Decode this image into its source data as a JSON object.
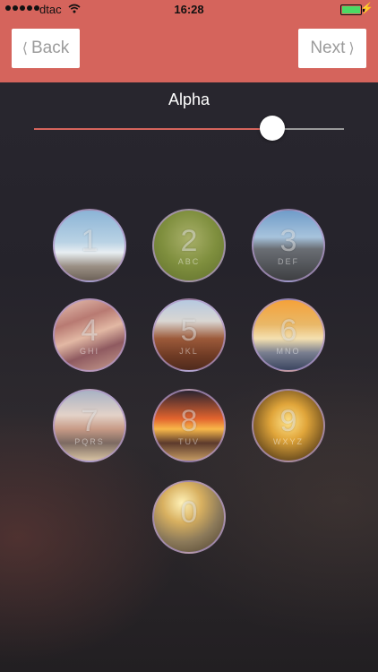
{
  "status_bar": {
    "carrier": "dtac",
    "time": "16:28"
  },
  "nav": {
    "back_label": "Back",
    "next_label": "Next",
    "back_chevron": "⟨",
    "next_chevron": "⟩"
  },
  "alpha": {
    "label": "Alpha",
    "value": 0.77
  },
  "colors": {
    "accent": "#d5645c",
    "key_border": "#af96c8"
  },
  "keypad": {
    "keys": [
      {
        "digit": "1",
        "letters": ""
      },
      {
        "digit": "2",
        "letters": "ABC"
      },
      {
        "digit": "3",
        "letters": "DEF"
      },
      {
        "digit": "4",
        "letters": "GHI"
      },
      {
        "digit": "5",
        "letters": "JKL"
      },
      {
        "digit": "6",
        "letters": "MNO"
      },
      {
        "digit": "7",
        "letters": "PQRS"
      },
      {
        "digit": "8",
        "letters": "TUV"
      },
      {
        "digit": "9",
        "letters": "WXYZ"
      },
      {
        "digit": "0",
        "letters": ""
      }
    ]
  }
}
